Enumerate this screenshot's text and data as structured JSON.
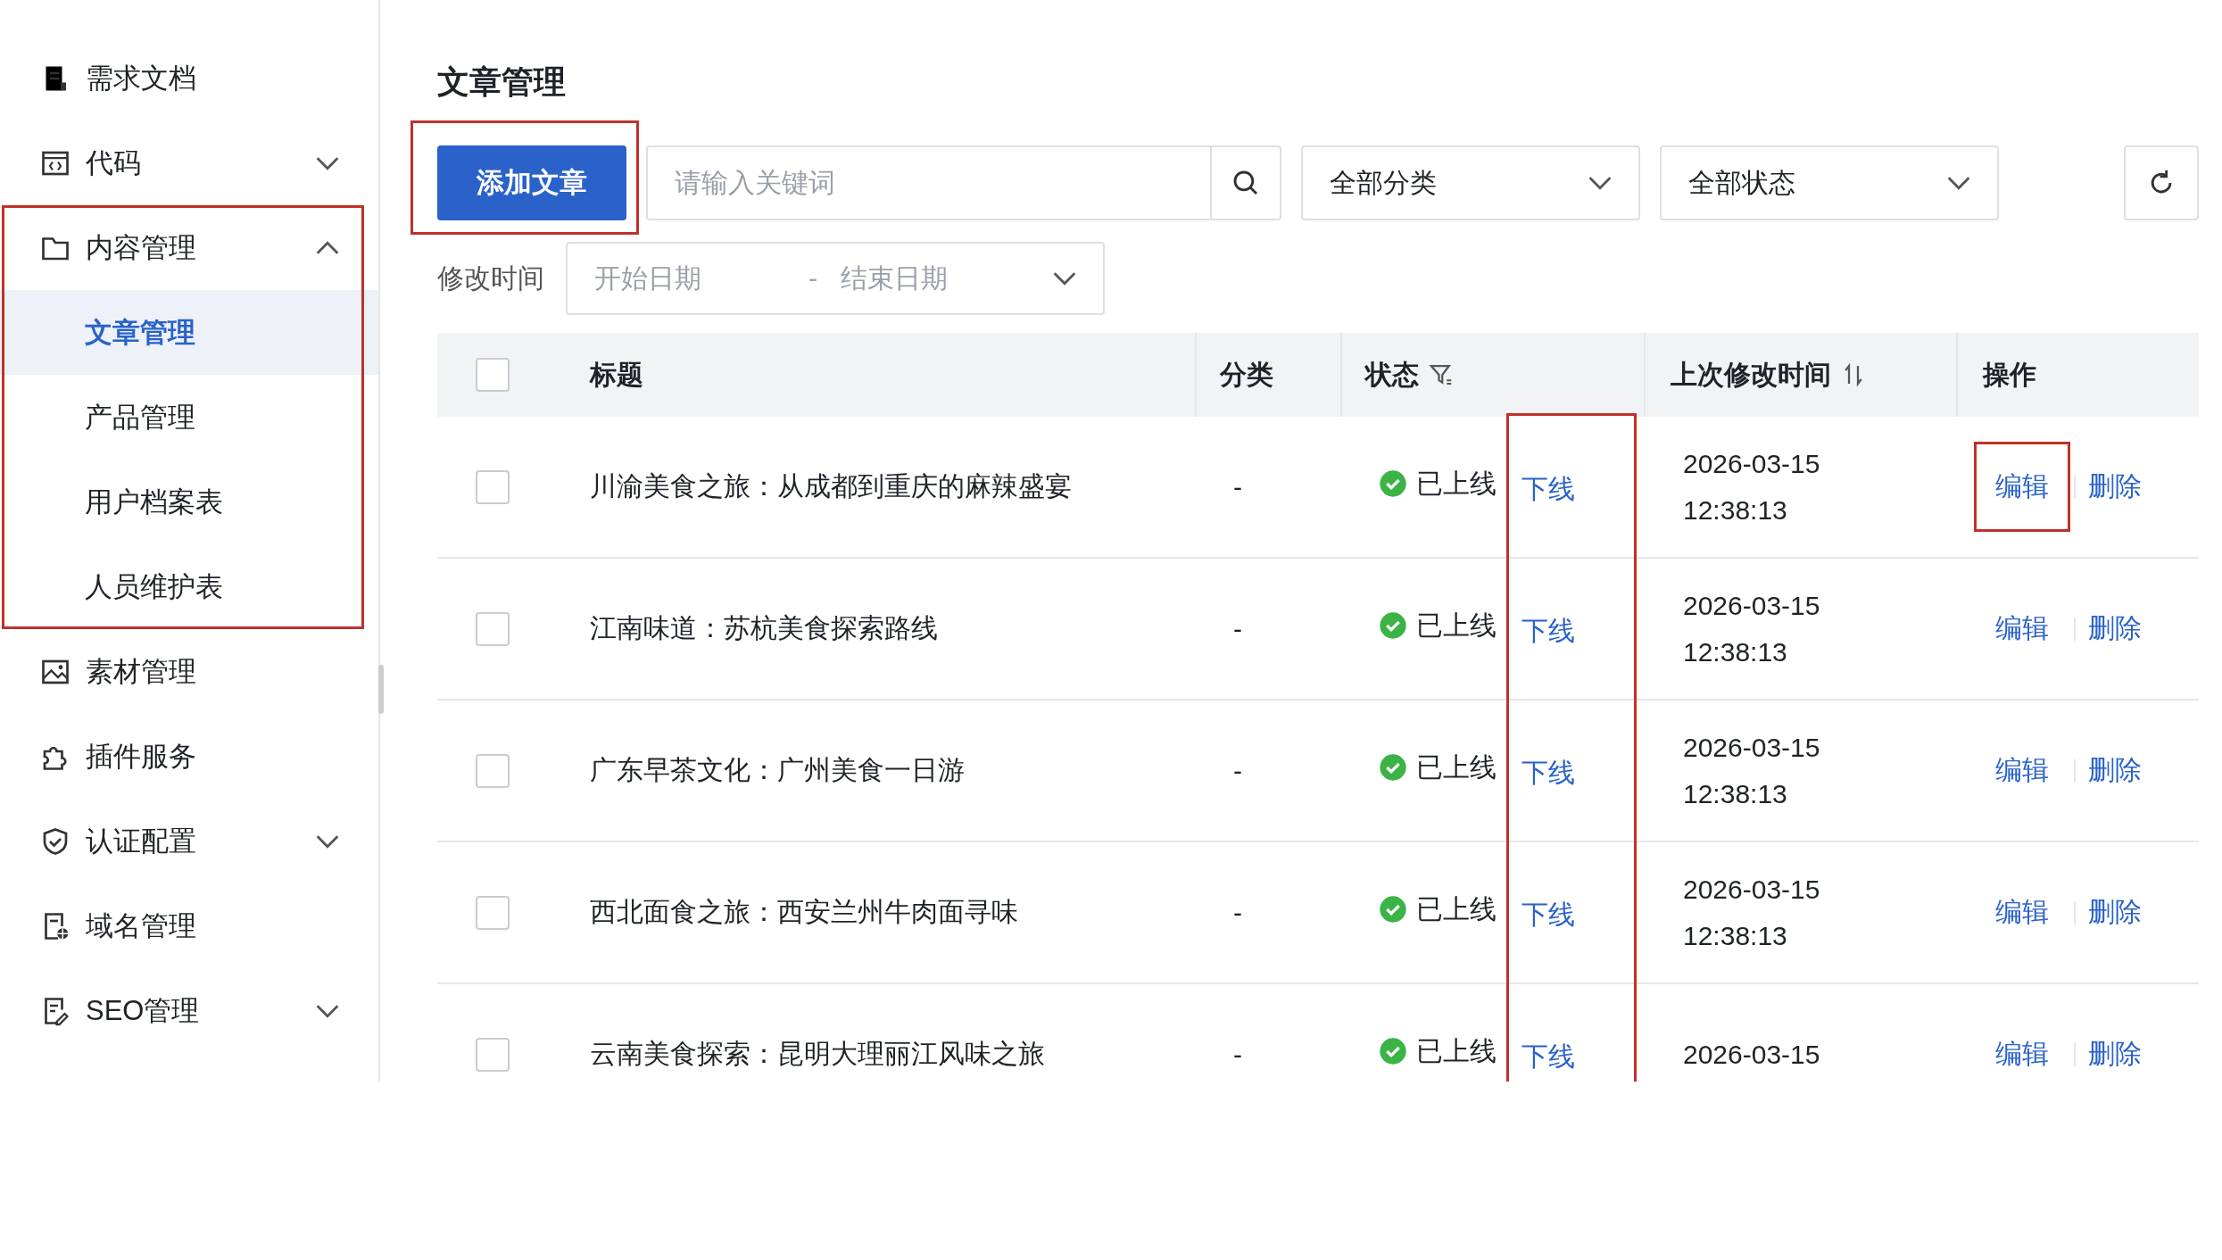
{
  "sidebar": {
    "items": [
      {
        "label": "需求文档",
        "highlighted": false
      },
      {
        "label": "代码",
        "expanded": false,
        "highlighted": false
      },
      {
        "label": "内容管理",
        "expanded": true,
        "highlighted": true,
        "children": [
          {
            "label": "文章管理",
            "selected": true
          },
          {
            "label": "产品管理",
            "selected": false
          },
          {
            "label": "用户档案表",
            "selected": false
          },
          {
            "label": "人员维护表",
            "selected": false
          }
        ]
      },
      {
        "label": "素材管理",
        "highlighted": false
      },
      {
        "label": "插件服务",
        "highlighted": false
      },
      {
        "label": "认证配置",
        "expanded": false,
        "highlighted": false
      },
      {
        "label": "域名管理",
        "highlighted": false
      },
      {
        "label": "SEO管理",
        "expanded": false,
        "highlighted": false
      }
    ]
  },
  "page_title": "文章管理",
  "toolbar": {
    "add_button": {
      "label": "添加文章",
      "highlighted": true
    },
    "search": {
      "placeholder": "请输入关键词"
    },
    "category_select": {
      "value": "全部分类"
    },
    "status_select": {
      "value": "全部状态"
    }
  },
  "date_filter": {
    "label": "修改时间",
    "start_placeholder": "开始日期",
    "separator": "-",
    "end_placeholder": "结束日期"
  },
  "table": {
    "offline_column_highlighted": true,
    "header_checked": false,
    "columns": [
      "标题",
      "分类",
      "状态",
      "上次修改时间",
      "操作"
    ],
    "rows": [
      {
        "checked": false,
        "title": "川渝美食之旅：从成都到重庆的麻辣盛宴",
        "category": "-",
        "status": "已上线",
        "toggle": "下线",
        "modified": [
          "2026-03-15",
          "12:38:13"
        ],
        "edit": "编辑",
        "delete": "删除",
        "edit_highlighted": true
      },
      {
        "checked": false,
        "title": "江南味道：苏杭美食探索路线",
        "category": "-",
        "status": "已上线",
        "toggle": "下线",
        "modified": [
          "2026-03-15",
          "12:38:13"
        ],
        "edit": "编辑",
        "delete": "删除",
        "edit_highlighted": false
      },
      {
        "checked": false,
        "title": "广东早茶文化：广州美食一日游",
        "category": "-",
        "status": "已上线",
        "toggle": "下线",
        "modified": [
          "2026-03-15",
          "12:38:13"
        ],
        "edit": "编辑",
        "delete": "删除",
        "edit_highlighted": false
      },
      {
        "checked": false,
        "title": "西北面食之旅：西安兰州牛肉面寻味",
        "category": "-",
        "status": "已上线",
        "toggle": "下线",
        "modified": [
          "2026-03-15",
          "12:38:13"
        ],
        "edit": "编辑",
        "delete": "删除",
        "edit_highlighted": false
      },
      {
        "checked": false,
        "title": "云南美食探索：昆明大理丽江风味之旅",
        "category": "-",
        "status": "已上线",
        "toggle": "下线",
        "modified": [
          "2026-03-15"
        ],
        "edit": "编辑",
        "delete": "删除",
        "edit_highlighted": false
      }
    ]
  }
}
